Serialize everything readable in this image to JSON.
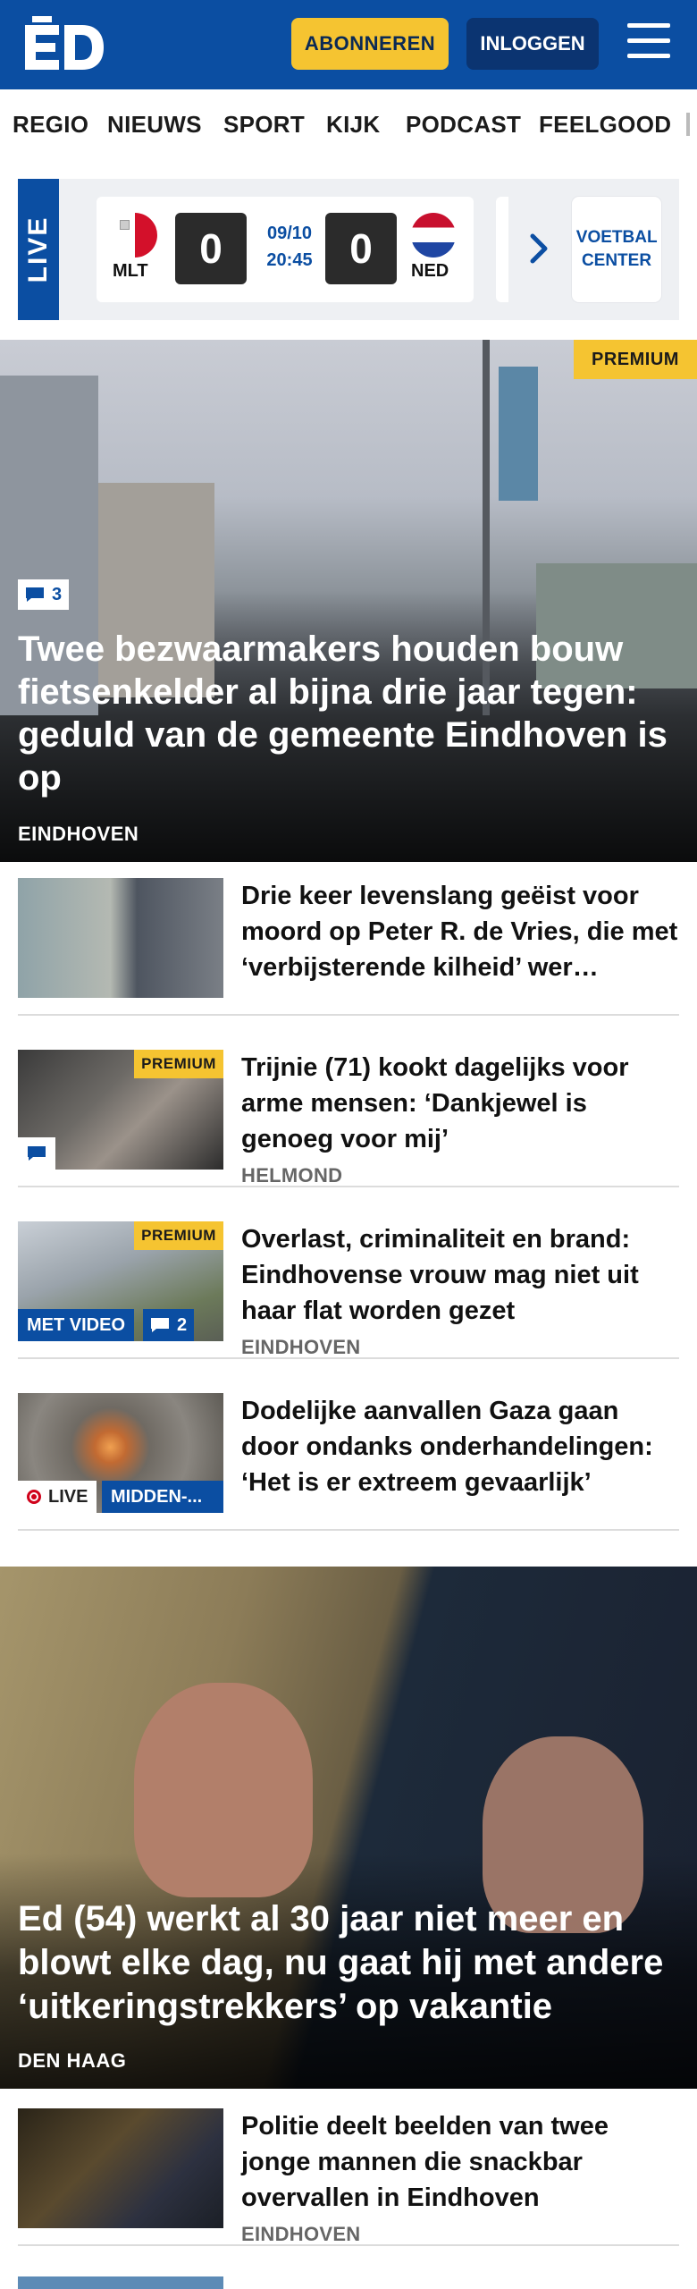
{
  "header": {
    "subscribe_label": "ABONNEREN",
    "login_label": "INLOGGEN",
    "colors": {
      "brand": "#0b4ea2",
      "accent": "#f5c431"
    }
  },
  "nav": {
    "items": [
      "REGIO",
      "NIEUWS",
      "SPORT",
      "KIJK",
      "PODCAST",
      "FEELGOOD"
    ]
  },
  "live": {
    "tab_label": "LIVE",
    "match": {
      "home_team": "MLT",
      "away_team": "NED",
      "home_score": "0",
      "away_score": "0",
      "date": "09/10",
      "time": "20:45"
    },
    "center_label": "VOETBAL CENTER"
  },
  "hero": {
    "premium_label": "PREMIUM",
    "comments": "3",
    "title": "Twee bezwaarmakers houden bouw fietsenkelder al bijna drie jaar tegen: geduld van de gemeente Eindhoven is op",
    "region": "EINDHOVEN"
  },
  "articles": [
    {
      "title": "Drie keer levenslang geëist voor moord op Peter R. de Vries, die met ‘verbijsterende kilheid’ wer…"
    },
    {
      "premium_label": "PREMIUM",
      "title": "Trijnie (71) kookt dagelijks voor arme mensen: ‘Dankjewel is genoeg voor mij’",
      "region": "HELMOND"
    },
    {
      "premium_label": "PREMIUM",
      "title": "Overlast, criminaliteit en brand: Eindhovense vrouw mag niet uit haar flat worden gezet",
      "region": "EINDHOVEN",
      "video_label": "MET VIDEO",
      "comments": "2"
    },
    {
      "title": "Dodelijke aanvallen Gaza gaan door ondanks onderhandelingen: ‘Het is er extreem gevaarlijk’",
      "live_label": "LIVE",
      "topic_label": "MIDDEN-..."
    }
  ],
  "hero2": {
    "title": "Ed (54) werkt al 30 jaar niet meer en blowt elke dag, nu gaat hij met andere ‘uitkeringstrekkers’ op vakantie",
    "region": "DEN HAAG"
  },
  "article_after": {
    "title": "Politie deelt beelden van twee jonge mannen die snackbar overvallen in Eindhoven",
    "region": "EINDHOVEN"
  }
}
